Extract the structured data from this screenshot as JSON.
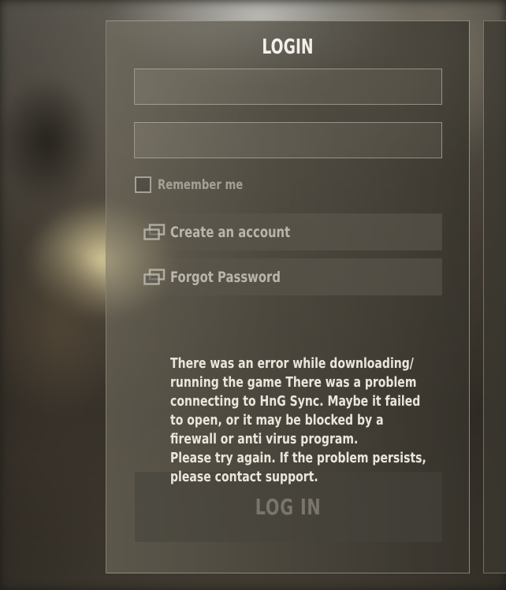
{
  "login": {
    "title": "LOGIN",
    "username_value": "",
    "password_value": "",
    "remember_label": "Remember me",
    "remember_checked": false,
    "links": [
      {
        "label": "Create an account",
        "icon": "external-window-icon"
      },
      {
        "label": "Forgot Password",
        "icon": "external-window-icon"
      }
    ],
    "error_message": "There was an error while downloading/\nrunning the game There was a problem\nconnecting to HnG Sync. Maybe it failed\nto open, or it may be blocked by a\nfirewall or anti virus program.\nPlease try again. If the problem persists,\nplease contact support.",
    "login_button_label": "LOG IN"
  },
  "colors": {
    "panel_border": "#bfb9aa",
    "text_primary": "#f2f0ea",
    "text_muted": "#bebab0",
    "button_text": "#827e76"
  }
}
